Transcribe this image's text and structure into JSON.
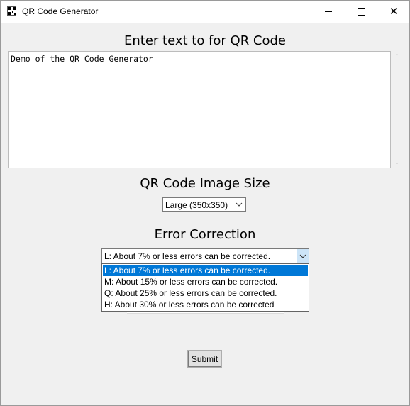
{
  "window": {
    "title": "QR Code Generator",
    "close_glyph": "✕"
  },
  "text_section": {
    "heading": "Enter text to for QR Code",
    "value": "Demo of the QR Code Generator",
    "scroll_up_glyph": "⌃",
    "scroll_down_glyph": "⌄"
  },
  "size_section": {
    "heading": "QR Code Image Size",
    "selected": "Large (350x350)"
  },
  "error_section": {
    "heading": "Error Correction",
    "selected": "L: About 7% or less errors can be corrected.",
    "options": [
      "L: About 7% or less errors can be corrected.",
      "M: About 15% or less errors can be corrected.",
      "Q: About 25% or less errors can be corrected.",
      "H: About 30% or less errors can be corrected"
    ],
    "highlight_color": "#0078d7"
  },
  "submit": {
    "label": "Submit"
  }
}
